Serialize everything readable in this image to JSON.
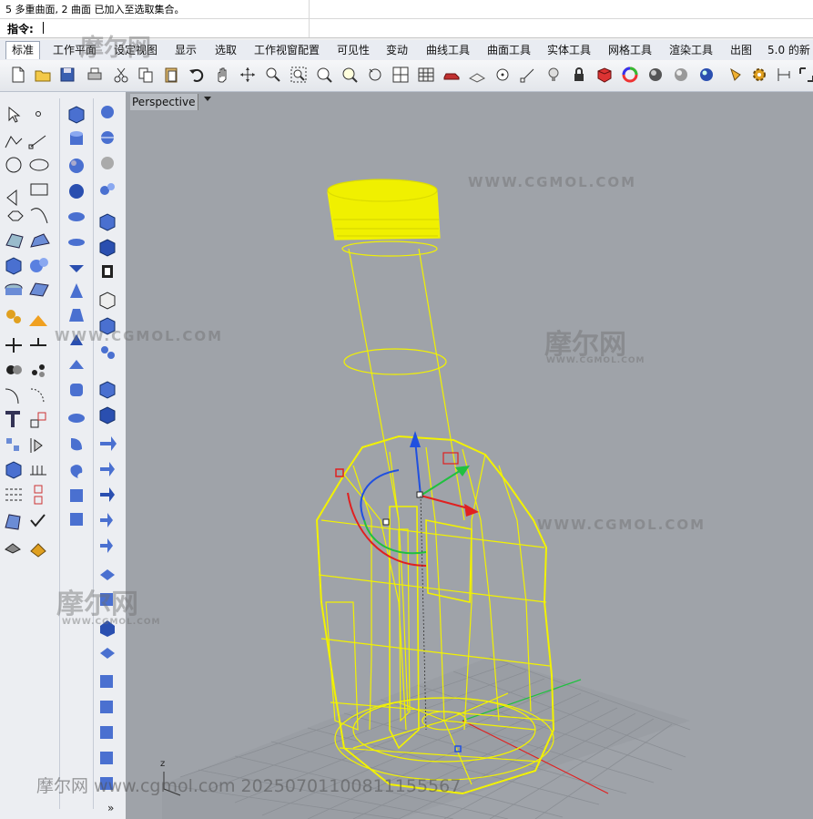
{
  "command": {
    "history": "5 多重曲面, 2 曲面 已加入至选取集合。",
    "prompt_label": "指令:"
  },
  "tabs": [
    "标准",
    "工作平面",
    "设定视图",
    "显示",
    "选取",
    "工作视窗配置",
    "可见性",
    "变动",
    "曲线工具",
    "曲面工具",
    "实体工具",
    "网格工具",
    "渲染工具",
    "出图",
    "5.0 的新"
  ],
  "active_tab": "标准",
  "viewport": {
    "title": "Perspective",
    "axis_label": "z"
  },
  "watermarks": {
    "cn": "摩尔网",
    "en": "WWW.CGMOL.COM",
    "en_small": "WWW.CGMOL.COM",
    "bottom": "摩尔网 www.cgmol.com 20250701100811155567"
  },
  "left_panel": {
    "more_label": "»"
  },
  "colors": {
    "wireframe": "#f2f200",
    "viewport_bg": "#9fa3a9",
    "grid": "#8a8e94",
    "x_axis": "#e02020",
    "y_axis": "#20c040",
    "z_axis": "#2050e0"
  }
}
